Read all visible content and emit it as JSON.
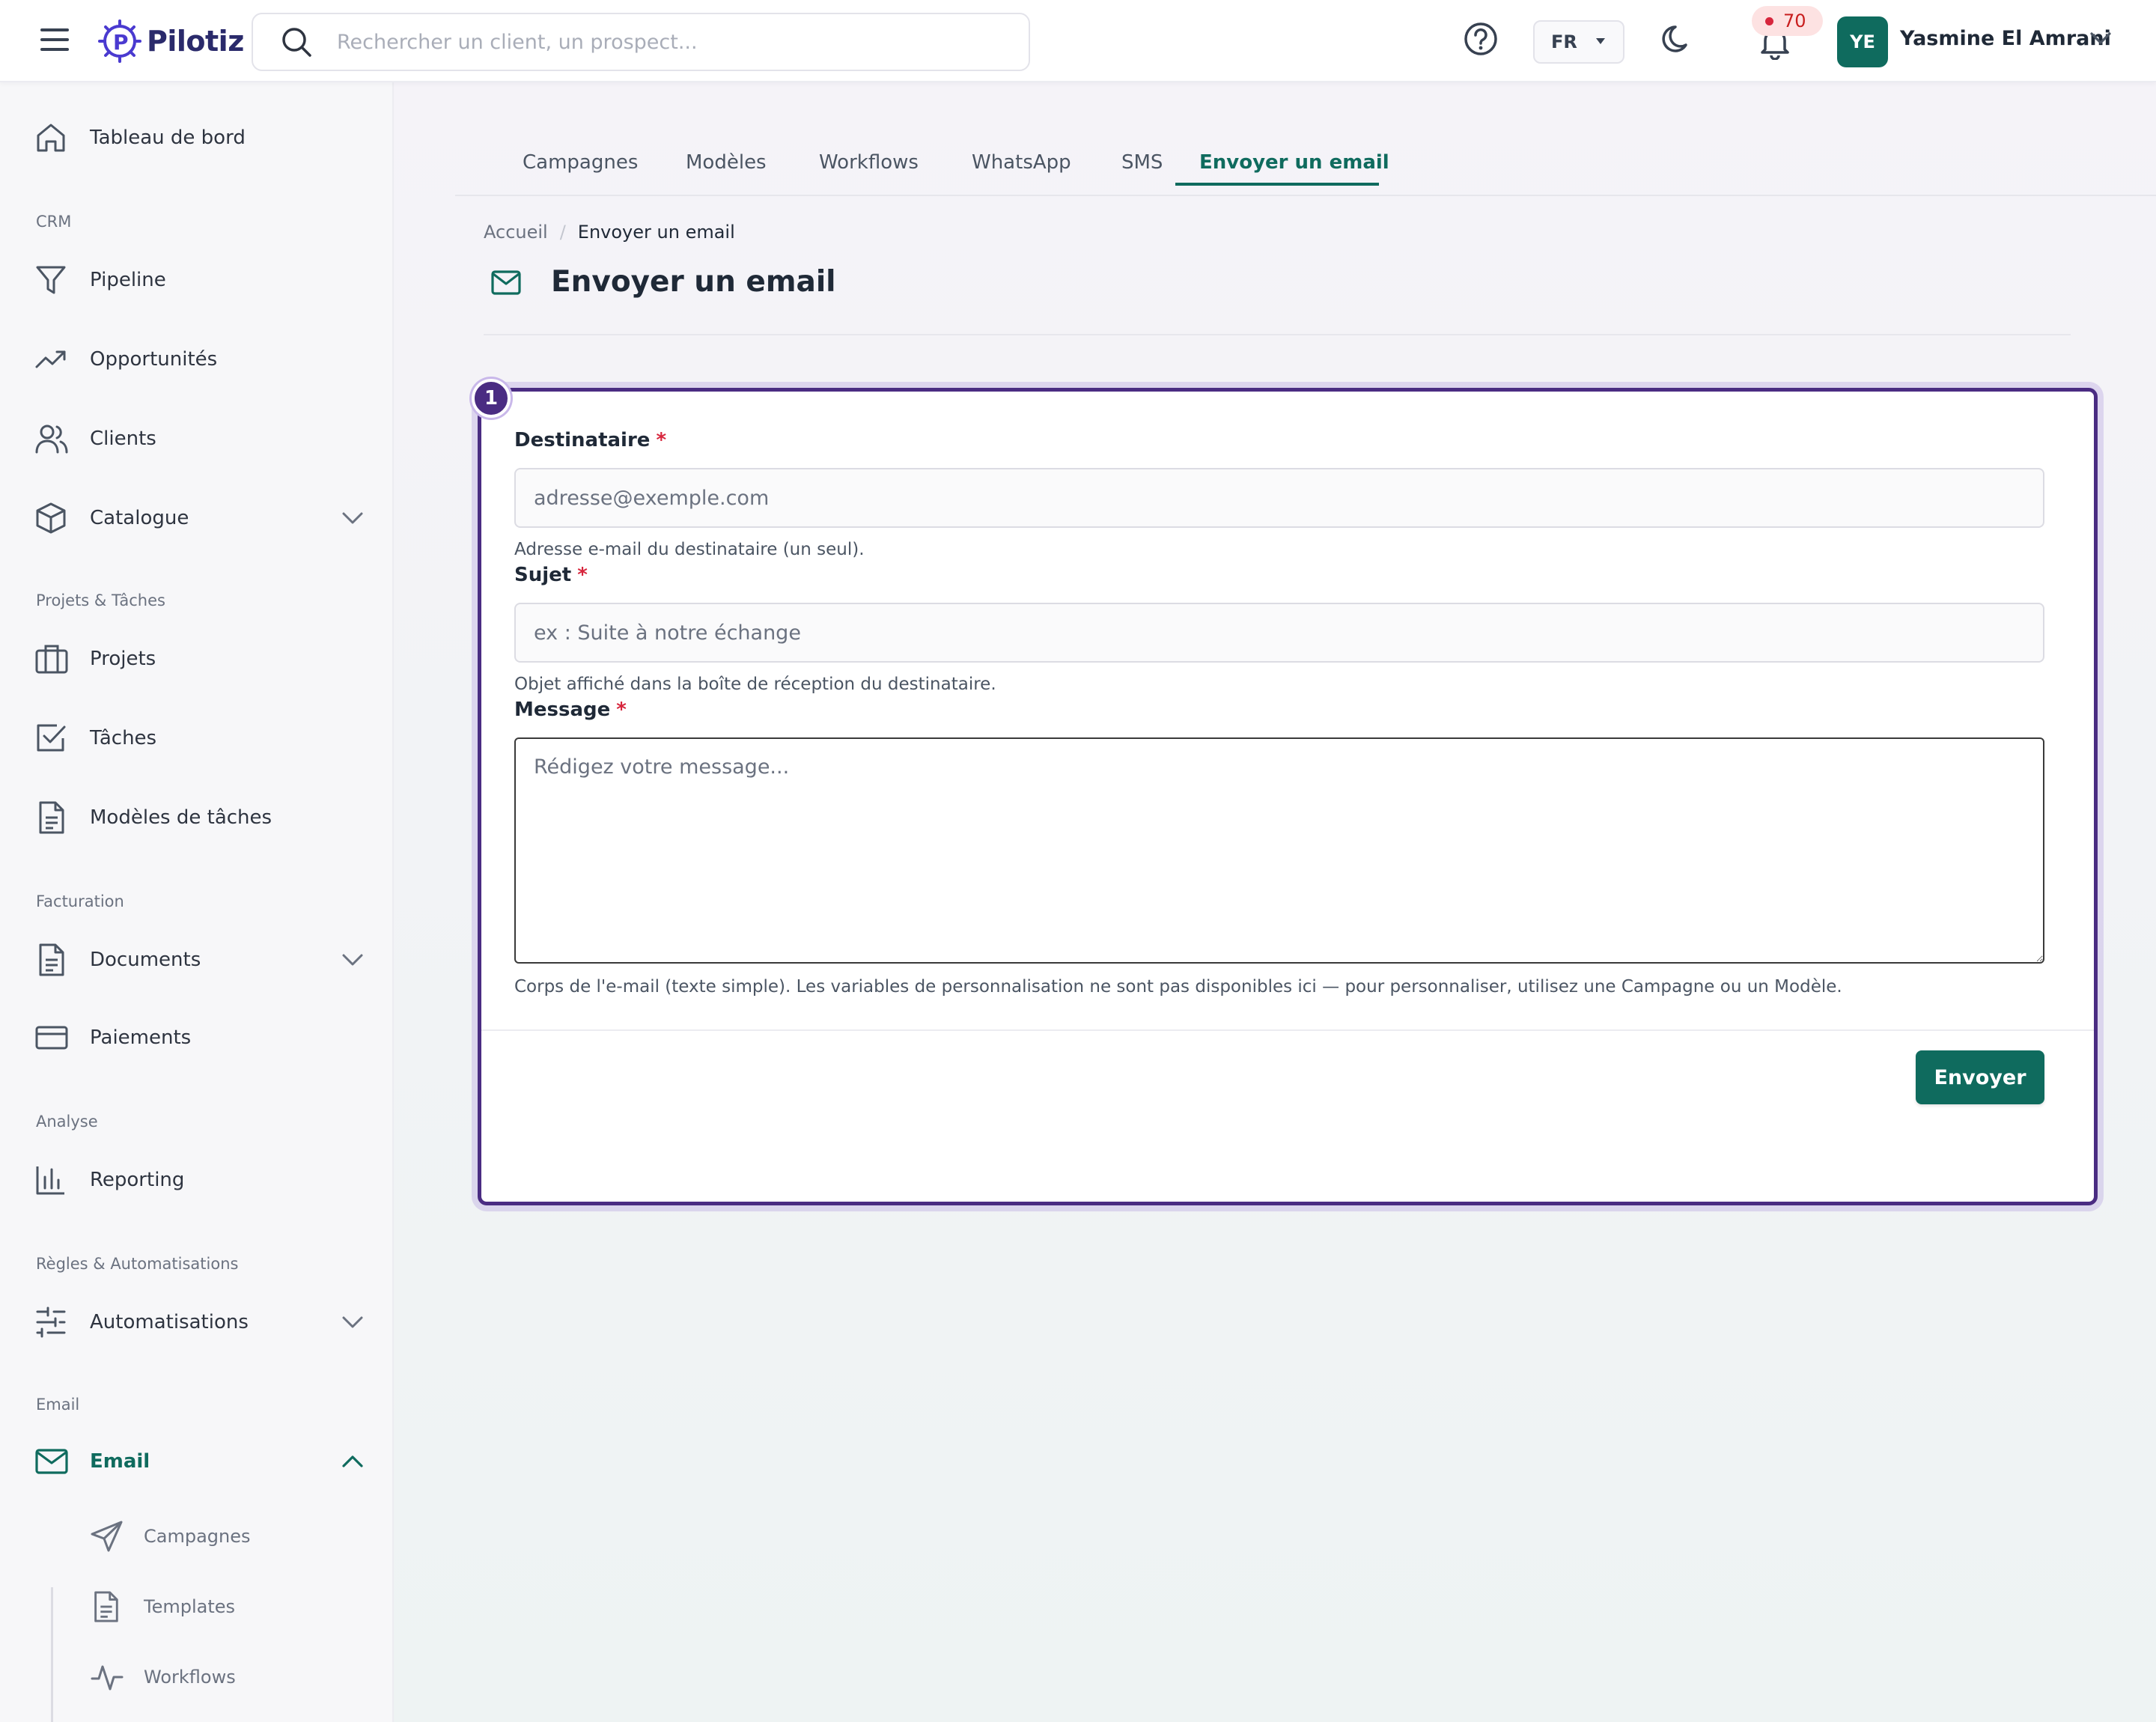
{
  "app": {
    "brand": "Pilotiz",
    "colors": {
      "accent": "#0f6b5e",
      "highlight": "#4a2c82",
      "badge": "#d7263d"
    }
  },
  "header": {
    "search_placeholder": "Rechercher un client, un prospect...",
    "language": "FR",
    "notifications_count": "70",
    "user_initials": "YE",
    "user_name": "Yasmine El Amrani",
    "icons": [
      "menu-icon",
      "search-icon",
      "help-icon",
      "moon-icon",
      "bell-icon",
      "chevron-down-icon"
    ]
  },
  "sidebar": {
    "dashboard": "Tableau de bord",
    "sections": {
      "crm": "CRM",
      "projects": "Projets & Tâches",
      "billing": "Facturation",
      "analysis": "Analyse",
      "rules": "Règles & Automatisations",
      "email": "Email"
    },
    "items": {
      "pipeline": "Pipeline",
      "opportunities": "Opportunités",
      "clients": "Clients",
      "catalogue": "Catalogue",
      "projects": "Projets",
      "tasks": "Tâches",
      "task_templates": "Modèles de tâches",
      "documents": "Documents",
      "payments": "Paiements",
      "reporting": "Reporting",
      "automations": "Automatisations",
      "email": "Email"
    },
    "email_submenu": {
      "campaigns": "Campagnes",
      "templates": "Templates",
      "workflows": "Workflows"
    }
  },
  "tabs": [
    {
      "label": "Campagnes"
    },
    {
      "label": "Modèles"
    },
    {
      "label": "Workflows"
    },
    {
      "label": "WhatsApp"
    },
    {
      "label": "SMS"
    },
    {
      "label": "Envoyer un email",
      "active": true
    }
  ],
  "breadcrumb": {
    "home": "Accueil",
    "separator": "/",
    "current": "Envoyer un email"
  },
  "page": {
    "title": "Envoyer un email"
  },
  "form": {
    "step": "1",
    "recipient": {
      "label": "Destinataire",
      "required_mark": "*",
      "placeholder": "adresse@exemple.com",
      "value": "",
      "hint": "Adresse e-mail du destinataire (un seul)."
    },
    "subject": {
      "label": "Sujet",
      "required_mark": "*",
      "placeholder": "ex : Suite à notre échange",
      "value": "",
      "hint": "Objet affiché dans la boîte de réception du destinataire."
    },
    "message": {
      "label": "Message",
      "required_mark": "*",
      "placeholder": "Rédigez votre message...",
      "value": "",
      "hint": "Corps de l'e-mail (texte simple). Les variables de personnalisation ne sont pas disponibles ici — pour personnaliser, utilisez une Campagne ou un Modèle."
    },
    "submit_label": "Envoyer"
  }
}
